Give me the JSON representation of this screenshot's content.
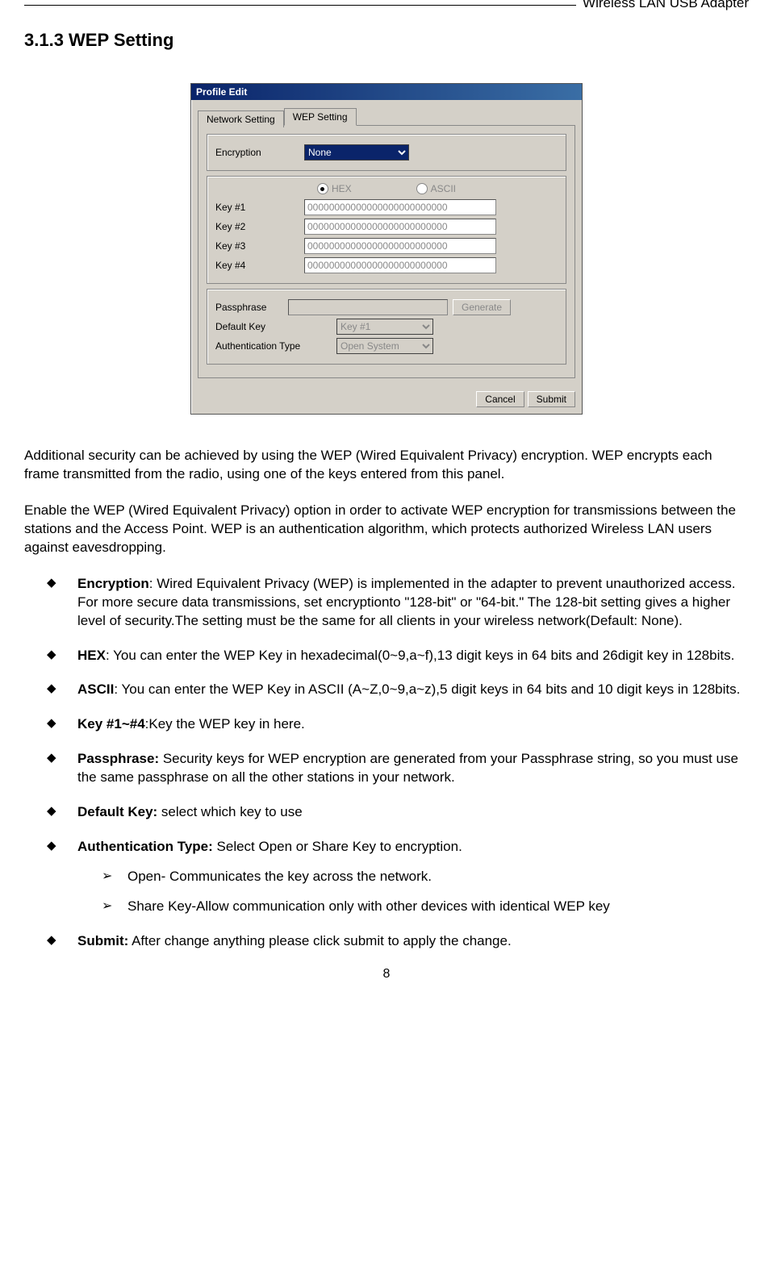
{
  "header": {
    "product": "Wireless LAN USB Adapter"
  },
  "section": {
    "number_title": "3.1.3 WEP Setting"
  },
  "dialog": {
    "title": "Profile Edit",
    "tabs": {
      "network": "Network Setting",
      "wep": "WEP Setting"
    },
    "encryption_label": "Encryption",
    "encryption_value": "None",
    "format": {
      "hex": "HEX",
      "ascii": "ASCII"
    },
    "keys": {
      "k1_label": "Key #1",
      "k1_val": "00000000000000000000000000",
      "k2_label": "Key #2",
      "k2_val": "00000000000000000000000000",
      "k3_label": "Key #3",
      "k3_val": "00000000000000000000000000",
      "k4_label": "Key #4",
      "k4_val": "00000000000000000000000000"
    },
    "passphrase_label": "Passphrase",
    "generate_btn": "Generate",
    "defaultkey_label": "Default Key",
    "defaultkey_value": "Key #1",
    "authtype_label": "Authentication Type",
    "authtype_value": "Open System",
    "cancel_btn": "Cancel",
    "submit_btn": "Submit"
  },
  "paras": {
    "p1": "Additional security can be achieved by using the WEP (Wired Equivalent Privacy) encryption. WEP encrypts each frame transmitted from the radio, using one of the keys entered from this panel.",
    "p2": "Enable the WEP (Wired Equivalent Privacy) option in order to activate WEP encryption for transmissions between the stations and the Access Point. WEP is an authentication algorithm, which protects authorized Wireless LAN users against eavesdropping."
  },
  "bullets": {
    "encryption_term": "Encryption",
    "encryption_text": ": Wired Equivalent Privacy (WEP) is implemented in the adapter to prevent unauthorized access. For more secure data transmissions, set encryptionto \"128-bit\" or \"64-bit.\" The 128-bit setting gives a higher level of security.The setting must be the same for all clients in your wireless network(Default: None).",
    "hex_term": "HEX",
    "hex_text": ": You can enter the WEP Key in hexadecimal(0~9,a~f),13 digit keys in 64 bits and 26digit key in 128bits.",
    "ascii_term": "ASCII",
    "ascii_text": ": You can enter the WEP Key in ASCII (A~Z,0~9,a~z),5 digit keys in 64 bits and 10 digit keys in 128bits.",
    "key_term": "Key #1~#4",
    "key_text": ":Key the WEP key in here.",
    "pass_term": "Passphrase:",
    "pass_text": " Security keys for WEP encryption are generated from your Passphrase string, so you must use the same passphrase on all the other stations in your network.",
    "dk_term": "Default Key:",
    "dk_text": " select which key to use",
    "at_term": "Authentication Type:",
    "at_text": " Select Open or Share Key to encryption.",
    "open_text": "Open- Communicates the key across the network.",
    "share_text": "Share Key-Allow communication only with other devices with identical WEP key",
    "submit_term": "Submit:",
    "submit_text": " After change anything please click submit to apply the change."
  },
  "pagenum": "8"
}
